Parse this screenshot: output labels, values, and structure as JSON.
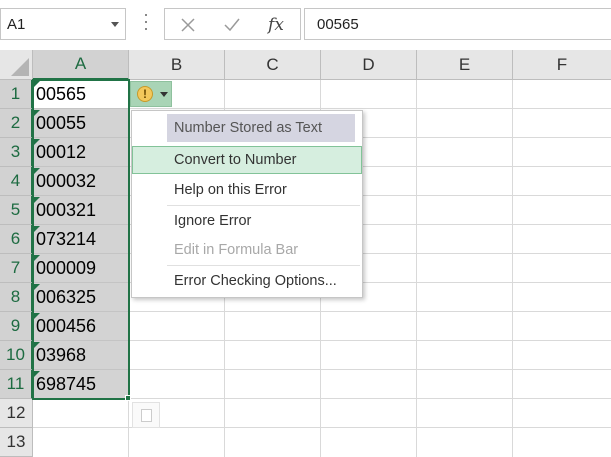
{
  "formula_bar": {
    "name_box": "A1",
    "cancel_icon": "close-icon",
    "enter_icon": "checkmark-icon",
    "function_label": "fx",
    "formula_value": "00565"
  },
  "columns": [
    "A",
    "B",
    "C",
    "D",
    "E",
    "F"
  ],
  "rows": [
    "1",
    "2",
    "3",
    "4",
    "5",
    "6",
    "7",
    "8",
    "9",
    "10",
    "11",
    "12",
    "13"
  ],
  "cells": {
    "A1": "00565",
    "A2": "00055",
    "A3": "00012",
    "A4": "000032",
    "A5": "000321",
    "A6": "073214",
    "A7": "000009",
    "A8": "006325",
    "A9": "000456",
    "A10": "03968",
    "A11": "698745"
  },
  "error_button": {
    "icon": "warning-icon",
    "glyph": "!"
  },
  "error_menu": {
    "header": "Number Stored as Text",
    "convert": "Convert to Number",
    "help": "Help on this Error",
    "ignore": "Ignore Error",
    "edit": "Edit in Formula Bar",
    "options": "Error Checking Options..."
  },
  "colors": {
    "accent": "#217346",
    "error_indicator": "#1e7145",
    "menu_highlight": "#d6eedf"
  }
}
